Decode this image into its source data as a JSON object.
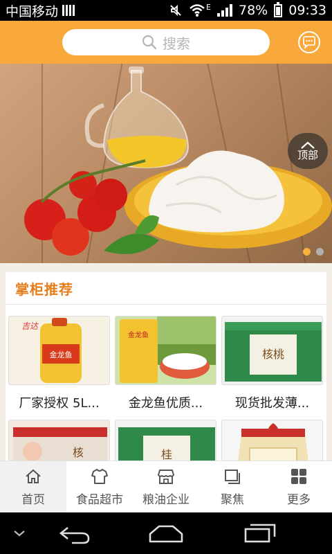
{
  "status_bar": {
    "carrier": "中国移动",
    "battery": "78%",
    "time": "09:33",
    "network_label": "E"
  },
  "header": {
    "search_placeholder": "搜索",
    "accent_color": "#f9a93b"
  },
  "banner": {
    "top_button_label": "顶部",
    "slide_count": 2,
    "active_slide": 1
  },
  "section": {
    "title": "掌柜推荐",
    "title_color": "#e77e1b",
    "products": [
      {
        "name": "厂家授权 5L..."
      },
      {
        "name": "金龙鱼优质..."
      },
      {
        "name": "现货批发薄..."
      }
    ],
    "partial_product_rows": 1
  },
  "bottom_nav": {
    "items": [
      {
        "label": "首页",
        "icon": "home-icon",
        "active": true
      },
      {
        "label": "食品超市",
        "icon": "shirt-icon",
        "active": false
      },
      {
        "label": "粮油企业",
        "icon": "store-icon",
        "active": false
      },
      {
        "label": "聚焦",
        "icon": "layers-icon",
        "active": false
      },
      {
        "label": "更多",
        "icon": "grid-icon",
        "active": false
      }
    ]
  },
  "system_bar": {
    "icons": [
      "chevron-down-icon",
      "back-icon",
      "home-outline-icon",
      "recent-apps-icon"
    ]
  }
}
